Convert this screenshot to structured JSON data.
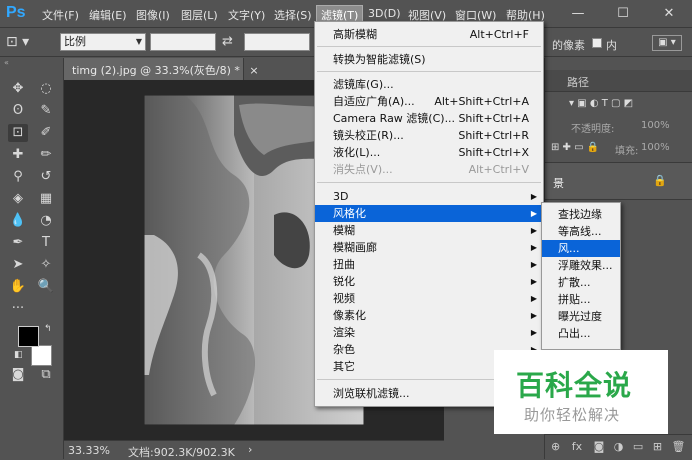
{
  "app": {
    "logo": "Ps"
  },
  "menubar": {
    "items": [
      {
        "label": "文件(F)"
      },
      {
        "label": "编辑(E)"
      },
      {
        "label": "图像(I)"
      },
      {
        "label": "图层(L)"
      },
      {
        "label": "文字(Y)"
      },
      {
        "label": "选择(S)"
      },
      {
        "label": "滤镜(T)"
      },
      {
        "label": "3D(D)"
      },
      {
        "label": "视图(V)"
      },
      {
        "label": "窗口(W)"
      },
      {
        "label": "帮助(H)"
      }
    ],
    "window_controls": {
      "minimize": "—",
      "maximize": "☐",
      "close": "✕"
    }
  },
  "options_bar": {
    "ratio_value": "比例",
    "swap_icon": "⇄",
    "right_text": "的像素",
    "checkbox_label": "内"
  },
  "document": {
    "tab_label": "timg (2).jpg @ 33.3%(灰色/8) *",
    "close": "×",
    "zoom": "33.33%",
    "doc_info": "文档:902.3K/902.3K"
  },
  "filter_menu": {
    "top_items": [
      {
        "label": "高斯模糊",
        "shortcut": "Alt+Ctrl+F"
      }
    ],
    "convert_item": {
      "label": "转换为智能滤镜(S)"
    },
    "gallery_items": [
      {
        "label": "滤镜库(G)...",
        "shortcut": ""
      },
      {
        "label": "自适应广角(A)...",
        "shortcut": "Alt+Shift+Ctrl+A"
      },
      {
        "label": "Camera Raw 滤镜(C)...",
        "shortcut": "Shift+Ctrl+A"
      },
      {
        "label": "镜头校正(R)...",
        "shortcut": "Shift+Ctrl+R"
      },
      {
        "label": "液化(L)...",
        "shortcut": "Shift+Ctrl+X"
      },
      {
        "label": "消失点(V)...",
        "shortcut": "Alt+Ctrl+V",
        "disabled": true
      }
    ],
    "submenus": [
      {
        "label": "3D"
      },
      {
        "label": "风格化",
        "highlighted": true
      },
      {
        "label": "模糊"
      },
      {
        "label": "模糊画廊"
      },
      {
        "label": "扭曲"
      },
      {
        "label": "锐化"
      },
      {
        "label": "视频"
      },
      {
        "label": "像素化"
      },
      {
        "label": "渲染"
      },
      {
        "label": "杂色"
      },
      {
        "label": "其它"
      }
    ],
    "browse_item": {
      "label": "浏览联机滤镜..."
    }
  },
  "stylize_submenu": {
    "items": [
      {
        "label": "查找边缘"
      },
      {
        "label": "等高线..."
      },
      {
        "label": "风...",
        "highlighted": true
      },
      {
        "label": "浮雕效果..."
      },
      {
        "label": "扩散..."
      },
      {
        "label": "拼贴..."
      },
      {
        "label": "曝光过度"
      },
      {
        "label": "凸出..."
      }
    ]
  },
  "right_panel": {
    "tab_paths": "路径",
    "opacity_label": "不透明度:",
    "opacity_value": "100%",
    "fill_label": "填充:",
    "fill_value": "100%",
    "layer_name": "景"
  },
  "watermark": {
    "title": "百科全说",
    "subtitle": "助你轻松解决"
  },
  "colors": {
    "menu_highlight": "#0a64d8",
    "ui_dark": "#535353",
    "logo": "#31a8ff",
    "watermark_green": "#2aa84a"
  }
}
